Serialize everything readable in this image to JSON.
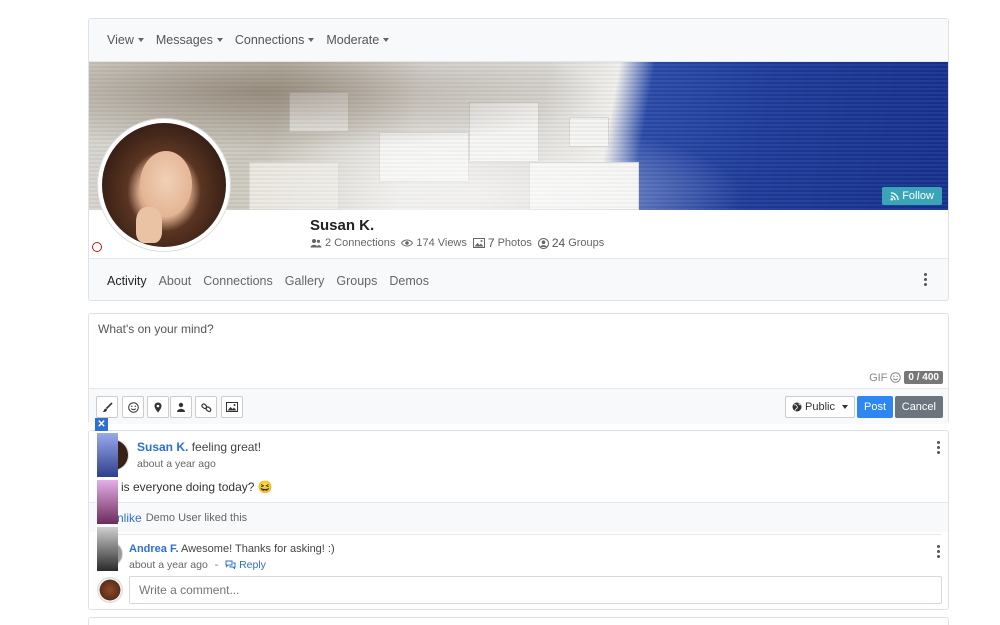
{
  "top_nav": [
    {
      "label": "View"
    },
    {
      "label": "Messages"
    },
    {
      "label": "Connections"
    },
    {
      "label": "Moderate"
    }
  ],
  "cover": {
    "follow_label": "Follow"
  },
  "profile": {
    "name": "Susan K.",
    "stats": {
      "connections": "2 Connections",
      "views": "174 Views",
      "photos_count": "7",
      "photos_label": "Photos",
      "groups_count": "24",
      "groups_label": "Groups"
    }
  },
  "sub_nav": [
    {
      "label": "Activity",
      "active": true
    },
    {
      "label": "About"
    },
    {
      "label": "Connections"
    },
    {
      "label": "Gallery"
    },
    {
      "label": "Groups"
    },
    {
      "label": "Demos"
    }
  ],
  "composer": {
    "placeholder": "What's on your mind?",
    "gif_label": "GIF",
    "char_count": "0 / 400",
    "privacy_label": "Public",
    "post_label": "Post",
    "cancel_label": "Cancel"
  },
  "post": {
    "author": "Susan K.",
    "action": "feeling great!",
    "time": "about a year ago",
    "body": "is everyone doing today? 😆",
    "unlike_label": "nlike",
    "likes_text": "Demo User liked this",
    "comment": {
      "author": "Andrea F.",
      "text": "Awesome! Thanks for asking! :)",
      "time": "about a year ago",
      "separator": "-",
      "reply_label": "Reply"
    },
    "comment_placeholder": "Write a comment..."
  },
  "colors": {
    "link": "#2e6fcf",
    "follow": "#3aa5b6",
    "post_button": "#2e86f3",
    "cancel_button": "#6c757d",
    "online_ring": "#c01818"
  }
}
